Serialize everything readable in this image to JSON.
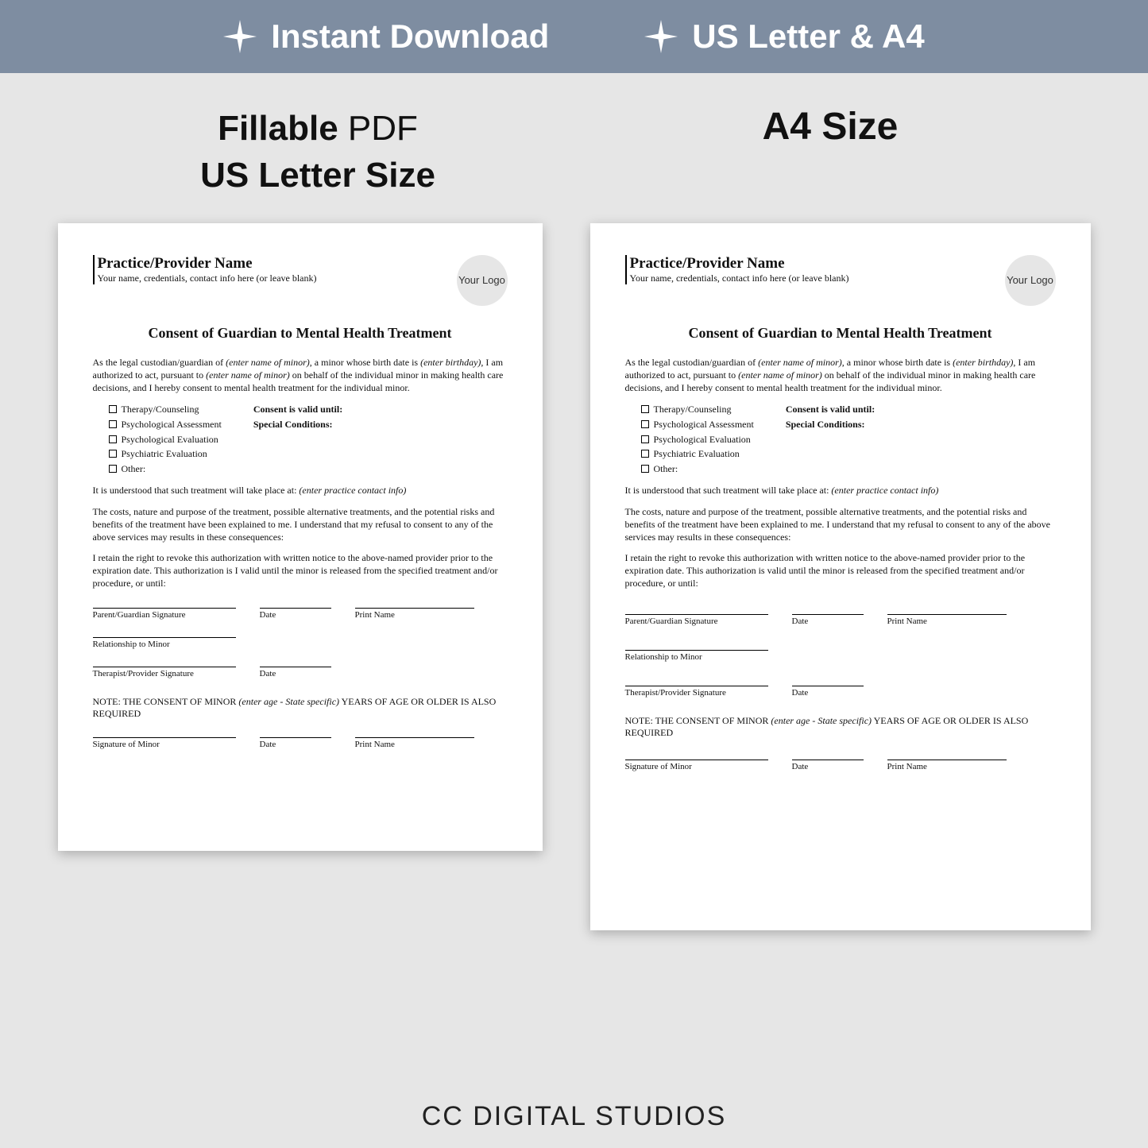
{
  "banner": {
    "item1": "Instant Download",
    "item2": "US Letter & A4"
  },
  "labels": {
    "left_bold": "Fillable",
    "left_rest": " PDF",
    "left_line2": "US Letter Size",
    "right": "A4 Size"
  },
  "doc": {
    "providerName": "Practice/Provider Name",
    "providerSub": "Your name, credentials, contact info here (or leave blank)",
    "logo": "Your Logo",
    "title": "Consent of Guardian to Mental Health Treatment",
    "p1a": "As the legal custodian/guardian of ",
    "p1i1": "(enter name of minor)",
    "p1b": ", a minor whose birth date is ",
    "p1i2": "(enter birthday)",
    "p1c": ", I am authorized to act, pursuant to ",
    "p1i3": "(enter name of minor)",
    "p1d": " on behalf of the individual  minor in making health care decisions, and I hereby consent to mental health treatment for the individual minor.",
    "checks": [
      "Therapy/Counseling",
      "Psychological Assessment",
      "Psychological Evaluation",
      "Psychiatric Evaluation",
      "Other:"
    ],
    "side1": "Consent is valid until:",
    "side2": "Special Conditions:",
    "p2a": "It is understood that such treatment will take place at: ",
    "p2i": "(enter practice contact info)",
    "p3": "The costs, nature and purpose of the treatment, possible alternative treatments, and the potential risks and benefits of the treatment have been explained to me.  I understand that my refusal to consent to any of the above services may results in these consequences:",
    "p4_us": "I retain the right to revoke this authorization with written notice to the above-named provider prior to the expiration date.  This authorization is I valid until the minor is released from the specified treatment and/or procedure, or until:",
    "p4_a4": "I retain the right to revoke this authorization with written notice to the above-named provider prior to the expiration date.  This authorization is valid until the minor is released from the specified treatment and/or procedure, or until:",
    "sig": {
      "parent": "Parent/Guardian Signature",
      "date": "Date",
      "print": "Print Name",
      "rel": "Relationship to Minor",
      "therapist": "Therapist/Provider Signature",
      "minor": "Signature of Minor"
    },
    "note_a": "NOTE:  THE CONSENT OF MINOR ",
    "note_i": "(enter age - State specific)",
    "note_b": " YEARS OF AGE OR OLDER IS ALSO REQUIRED"
  },
  "footer": "CC DIGITAL STUDIOS"
}
